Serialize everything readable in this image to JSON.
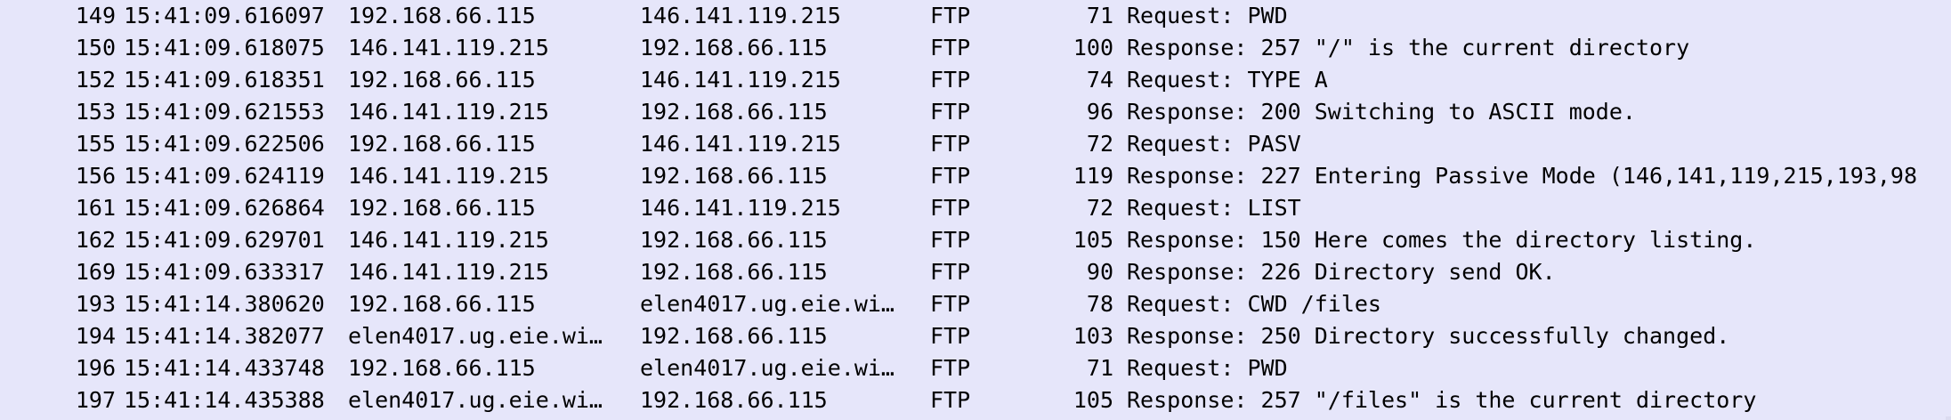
{
  "packet_list": {
    "rows": [
      {
        "no": "149",
        "time": "15:41:09.616097",
        "source": "192.168.66.115",
        "destination": "146.141.119.215",
        "protocol": "FTP",
        "length": "71",
        "info": "Request: PWD"
      },
      {
        "no": "150",
        "time": "15:41:09.618075",
        "source": "146.141.119.215",
        "destination": "192.168.66.115",
        "protocol": "FTP",
        "length": "100",
        "info": "Response: 257 \"/\" is the current directory"
      },
      {
        "no": "152",
        "time": "15:41:09.618351",
        "source": "192.168.66.115",
        "destination": "146.141.119.215",
        "protocol": "FTP",
        "length": "74",
        "info": "Request: TYPE A"
      },
      {
        "no": "153",
        "time": "15:41:09.621553",
        "source": "146.141.119.215",
        "destination": "192.168.66.115",
        "protocol": "FTP",
        "length": "96",
        "info": "Response: 200 Switching to ASCII mode."
      },
      {
        "no": "155",
        "time": "15:41:09.622506",
        "source": "192.168.66.115",
        "destination": "146.141.119.215",
        "protocol": "FTP",
        "length": "72",
        "info": "Request: PASV"
      },
      {
        "no": "156",
        "time": "15:41:09.624119",
        "source": "146.141.119.215",
        "destination": "192.168.66.115",
        "protocol": "FTP",
        "length": "119",
        "info": "Response: 227 Entering Passive Mode (146,141,119,215,193,98"
      },
      {
        "no": "161",
        "time": "15:41:09.626864",
        "source": "192.168.66.115",
        "destination": "146.141.119.215",
        "protocol": "FTP",
        "length": "72",
        "info": "Request: LIST"
      },
      {
        "no": "162",
        "time": "15:41:09.629701",
        "source": "146.141.119.215",
        "destination": "192.168.66.115",
        "protocol": "FTP",
        "length": "105",
        "info": "Response: 150 Here comes the directory listing."
      },
      {
        "no": "169",
        "time": "15:41:09.633317",
        "source": "146.141.119.215",
        "destination": "192.168.66.115",
        "protocol": "FTP",
        "length": "90",
        "info": "Response: 226 Directory send OK."
      },
      {
        "no": "193",
        "time": "15:41:14.380620",
        "source": "192.168.66.115",
        "destination": "elen4017.ug.eie.wi…",
        "protocol": "FTP",
        "length": "78",
        "info": "Request: CWD /files"
      },
      {
        "no": "194",
        "time": "15:41:14.382077",
        "source": "elen4017.ug.eie.wi…",
        "destination": "192.168.66.115",
        "protocol": "FTP",
        "length": "103",
        "info": "Response: 250 Directory successfully changed."
      },
      {
        "no": "196",
        "time": "15:41:14.433748",
        "source": "192.168.66.115",
        "destination": "elen4017.ug.eie.wi…",
        "protocol": "FTP",
        "length": "71",
        "info": "Request: PWD"
      },
      {
        "no": "197",
        "time": "15:41:14.435388",
        "source": "elen4017.ug.eie.wi…",
        "destination": "192.168.66.115",
        "protocol": "FTP",
        "length": "105",
        "info": "Response: 257 \"/files\" is the current directory"
      }
    ]
  },
  "colors": {
    "row_background": "#e6e6fa",
    "text": "#000000"
  }
}
